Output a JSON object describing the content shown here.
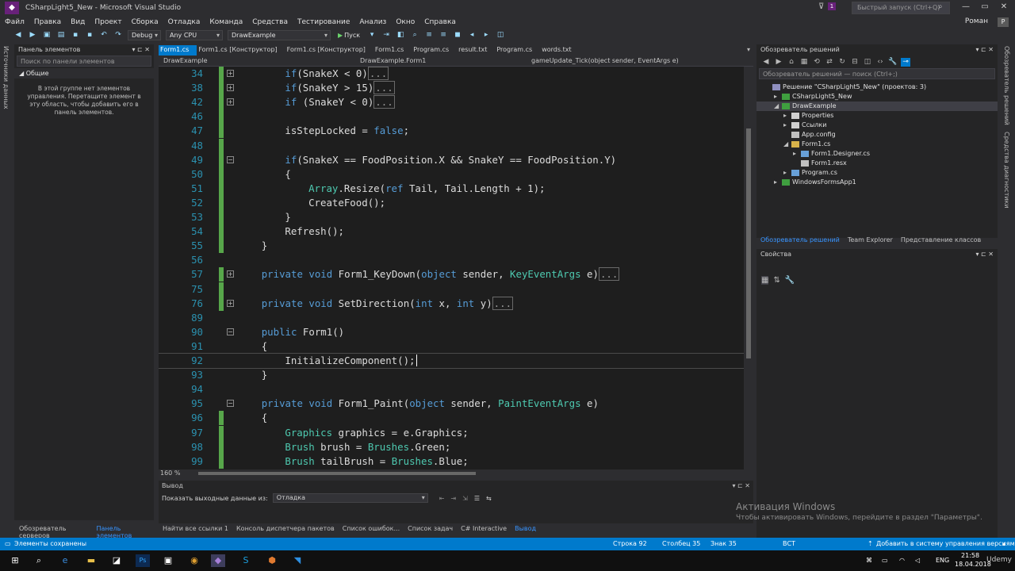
{
  "window": {
    "title": "CSharpLight5_New - Microsoft Visual Studio",
    "quick_launch_placeholder": "Быстрый запуск (Ctrl+Q)",
    "user": "Роман",
    "notification_count": "1"
  },
  "menu": [
    "Файл",
    "Правка",
    "Вид",
    "Проект",
    "Сборка",
    "Отладка",
    "Команда",
    "Средства",
    "Тестирование",
    "Анализ",
    "Окно",
    "Справка"
  ],
  "toolbar": {
    "configuration": "Debug",
    "platform": "Any CPU",
    "startup_project": "DrawExample",
    "run_label": "Пуск"
  },
  "left_strip_label": "Источники данных",
  "toolbox": {
    "title": "Панель элементов",
    "search_placeholder": "Поиск по панели элементов",
    "group": "Общие",
    "empty_message": "В этой группе нет элементов управления. Перетащите элемент в эту область, чтобы добавить его в панель элементов."
  },
  "bottom_left_tabs": [
    "Обозреватель серверов",
    "Панель элементов"
  ],
  "doc_tabs": [
    {
      "label": "Form1.cs",
      "active": true
    },
    {
      "label": "Form1.cs [Конструктор]",
      "active": false
    },
    {
      "label": "Form1.cs [Конструктор]",
      "active": false
    },
    {
      "label": "Form1.cs",
      "active": false
    },
    {
      "label": "Program.cs",
      "active": false
    },
    {
      "label": "result.txt",
      "active": false
    },
    {
      "label": "Program.cs",
      "active": false
    },
    {
      "label": "words.txt",
      "active": false
    }
  ],
  "navbar": {
    "project": "DrawExample",
    "class": "DrawExample.Form1",
    "member": "gameUpdate_Tick(object sender, EventArgs e)"
  },
  "code_lines": [
    {
      "n": "34",
      "fold": "+",
      "chg": true,
      "html": "<span class='kw'>if</span>(SnakeX &lt; 0)<span class='box'>...</span>",
      "indent": 2
    },
    {
      "n": "38",
      "fold": "+",
      "chg": true,
      "html": "<span class='kw'>if</span>(SnakeY &gt; 15)<span class='box'>...</span>",
      "indent": 2
    },
    {
      "n": "42",
      "fold": "+",
      "chg": true,
      "html": "<span class='kw'>if</span> (SnakeY &lt; 0)<span class='box'>...</span>",
      "indent": 2
    },
    {
      "n": "46",
      "fold": "",
      "chg": true,
      "html": "",
      "indent": 0
    },
    {
      "n": "47",
      "fold": "",
      "chg": true,
      "html": "isStepLocked = <span class='kw'>false</span>;",
      "indent": 2
    },
    {
      "n": "48",
      "fold": "",
      "chg": true,
      "html": "",
      "indent": 0
    },
    {
      "n": "49",
      "fold": "-",
      "chg": true,
      "html": "<span class='kw'>if</span>(SnakeX == FoodPosition.X &amp;&amp; SnakeY == FoodPosition.Y)",
      "indent": 2
    },
    {
      "n": "50",
      "fold": "",
      "chg": true,
      "html": "{",
      "indent": 2
    },
    {
      "n": "51",
      "fold": "",
      "chg": true,
      "html": "<span class='tp'>Array</span>.Resize(<span class='kw'>ref</span> Tail, Tail.Length + 1);",
      "indent": 3
    },
    {
      "n": "52",
      "fold": "",
      "chg": true,
      "html": "CreateFood();",
      "indent": 3
    },
    {
      "n": "53",
      "fold": "",
      "chg": true,
      "html": "}",
      "indent": 2
    },
    {
      "n": "54",
      "fold": "",
      "chg": true,
      "html": "Refresh();",
      "indent": 2
    },
    {
      "n": "55",
      "fold": "",
      "chg": true,
      "html": "}",
      "indent": 1
    },
    {
      "n": "56",
      "fold": "",
      "chg": false,
      "html": "",
      "indent": 0
    },
    {
      "n": "57",
      "fold": "+",
      "chg": true,
      "html": "<span class='kw'>private void</span> Form1_KeyDown(<span class='kw'>object</span> sender, <span class='tp'>KeyEventArgs</span> e)<span class='box'>...</span>",
      "indent": 1
    },
    {
      "n": "75",
      "fold": "",
      "chg": true,
      "html": "",
      "indent": 0
    },
    {
      "n": "76",
      "fold": "+",
      "chg": true,
      "html": "<span class='kw'>private void</span> SetDirection(<span class='kw'>int</span> x, <span class='kw'>int</span> y)<span class='box'>...</span>",
      "indent": 1
    },
    {
      "n": "89",
      "fold": "",
      "chg": false,
      "html": "",
      "indent": 0
    },
    {
      "n": "90",
      "fold": "-",
      "chg": false,
      "html": "<span class='kw'>public</span> Form1()",
      "indent": 1
    },
    {
      "n": "91",
      "fold": "",
      "chg": false,
      "html": "{",
      "indent": 1
    },
    {
      "n": "92",
      "fold": "",
      "chg": false,
      "html": "InitializeComponent();",
      "indent": 2,
      "current": true
    },
    {
      "n": "93",
      "fold": "",
      "chg": false,
      "html": "}",
      "indent": 1
    },
    {
      "n": "94",
      "fold": "",
      "chg": false,
      "html": "",
      "indent": 0
    },
    {
      "n": "95",
      "fold": "-",
      "chg": false,
      "html": "<span class='kw'>private void</span> Form1_Paint(<span class='kw'>object</span> sender, <span class='tp'>PaintEventArgs</span> e)",
      "indent": 1
    },
    {
      "n": "96",
      "fold": "",
      "chg": true,
      "html": "{",
      "indent": 1
    },
    {
      "n": "97",
      "fold": "",
      "chg": true,
      "html": "<span class='tp'>Graphics</span> graphics = e.Graphics;",
      "indent": 2
    },
    {
      "n": "98",
      "fold": "",
      "chg": true,
      "html": "<span class='tp'>Brush</span> brush = <span class='tp'>Brushes</span>.Green;",
      "indent": 2
    },
    {
      "n": "99",
      "fold": "",
      "chg": true,
      "html": "<span class='tp'>Brush</span> tailBrush = <span class='tp'>Brushes</span>.Blue;",
      "indent": 2
    }
  ],
  "zoom": "160 %",
  "output": {
    "title": "Вывод",
    "show_label": "Показать выходные данные из:",
    "source": "Отладка"
  },
  "bottom_tabs": [
    {
      "label": "Найти все ссылки 1",
      "active": false
    },
    {
      "label": "Консоль диспетчера пакетов",
      "active": false
    },
    {
      "label": "Список ошибок...",
      "active": false
    },
    {
      "label": "Список задач",
      "active": false
    },
    {
      "label": "C# Interactive",
      "active": false
    },
    {
      "label": "Вывод",
      "active": true
    }
  ],
  "solution": {
    "title": "Обозреватель решений",
    "search_placeholder": "Обозреватель решений — поиск (Ctrl+;)",
    "tree": [
      {
        "label": "Решение \"CSharpLight5_New\" (проектов: 3)",
        "level": 0,
        "arrow": "",
        "icon": "#8f8fbf"
      },
      {
        "label": "CSharpLight5_New",
        "level": 1,
        "arrow": "▸",
        "icon": "#3f9f3f"
      },
      {
        "label": "DrawExample",
        "level": 1,
        "arrow": "◢",
        "icon": "#3f9f3f",
        "selected": true
      },
      {
        "label": "Properties",
        "level": 2,
        "arrow": "▸",
        "icon": "#d0d0d0"
      },
      {
        "label": "Ссылки",
        "level": 2,
        "arrow": "▸",
        "icon": "#d0d0d0"
      },
      {
        "label": "App.config",
        "level": 2,
        "arrow": "",
        "icon": "#c0c0c0"
      },
      {
        "label": "Form1.cs",
        "level": 2,
        "arrow": "◢",
        "icon": "#d8b34a"
      },
      {
        "label": "Form1.Designer.cs",
        "level": 3,
        "arrow": "▸",
        "icon": "#68a0d8"
      },
      {
        "label": "Form1.resx",
        "level": 3,
        "arrow": "",
        "icon": "#c0c0c0"
      },
      {
        "label": "Program.cs",
        "level": 2,
        "arrow": "▸",
        "icon": "#68a0d8"
      },
      {
        "label": "WindowsFormsApp1",
        "level": 1,
        "arrow": "▸",
        "icon": "#3f9f3f"
      }
    ],
    "tabs": [
      {
        "label": "Обозреватель решений",
        "active": true
      },
      {
        "label": "Team Explorer",
        "active": false
      },
      {
        "label": "Представление классов",
        "active": false
      }
    ]
  },
  "properties": {
    "title": "Свойства"
  },
  "right_strip_labels": [
    "Обозреватель решений",
    "Средства диагностики"
  ],
  "activation": {
    "title": "Активация Windows",
    "subtitle": "Чтобы активировать Windows, перейдите в раздел \"Параметры\"."
  },
  "statusbar": {
    "message": "Элементы сохранены",
    "line": "Строка 92",
    "column": "Столбец 35",
    "char": "Знак 35",
    "mode": "ВСТ",
    "source_control": "Добавить в систему управления версиями"
  },
  "taskbar": {
    "lang": "ENG",
    "time": "21:58",
    "date": "18.04.2018",
    "watermark": "Udemy"
  },
  "colors": {
    "accent": "#007acc",
    "keyword": "#569cd6",
    "type": "#4ec9b0",
    "line_number": "#2b91af",
    "changed_marker": "#57a64a"
  }
}
